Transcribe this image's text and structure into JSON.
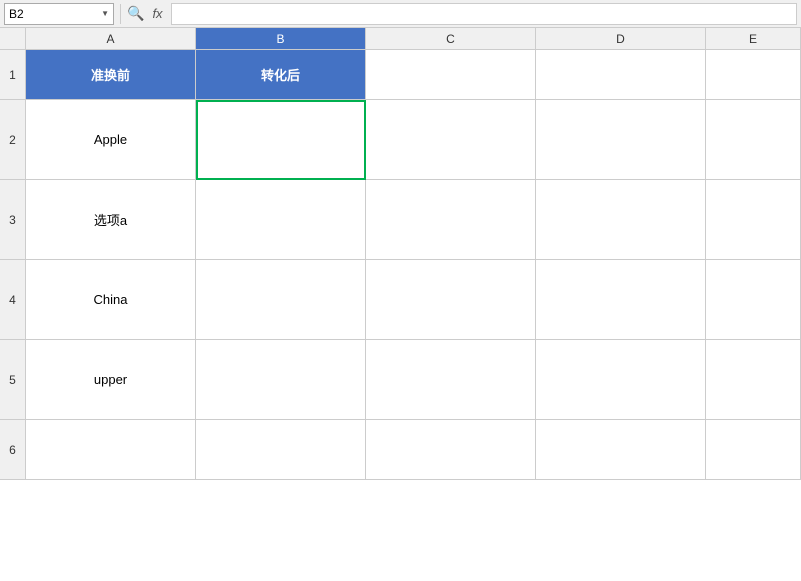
{
  "namebox": {
    "value": "B2",
    "arrow": "▼"
  },
  "formula_bar": {
    "zoom_icon": "🔍",
    "fx_label": "fx"
  },
  "columns": [
    {
      "id": "row_num",
      "label": ""
    },
    {
      "id": "A",
      "label": "A"
    },
    {
      "id": "B",
      "label": "B"
    },
    {
      "id": "C",
      "label": "C"
    },
    {
      "id": "D",
      "label": "D"
    },
    {
      "id": "E",
      "label": "E"
    }
  ],
  "rows": [
    {
      "num": "1",
      "cells": [
        {
          "col": "A",
          "value": "准换前",
          "type": "header"
        },
        {
          "col": "B",
          "value": "转化后",
          "type": "header"
        },
        {
          "col": "C",
          "value": "",
          "type": "empty"
        },
        {
          "col": "D",
          "value": "",
          "type": "empty"
        },
        {
          "col": "E",
          "value": "",
          "type": "empty"
        }
      ]
    },
    {
      "num": "2",
      "cells": [
        {
          "col": "A",
          "value": "Apple",
          "type": "normal"
        },
        {
          "col": "B",
          "value": "",
          "type": "selected"
        },
        {
          "col": "C",
          "value": "",
          "type": "empty"
        },
        {
          "col": "D",
          "value": "",
          "type": "empty"
        },
        {
          "col": "E",
          "value": "",
          "type": "empty"
        }
      ]
    },
    {
      "num": "3",
      "cells": [
        {
          "col": "A",
          "value": "选项a",
          "type": "normal"
        },
        {
          "col": "B",
          "value": "",
          "type": "normal"
        },
        {
          "col": "C",
          "value": "",
          "type": "empty"
        },
        {
          "col": "D",
          "value": "",
          "type": "empty"
        },
        {
          "col": "E",
          "value": "",
          "type": "empty"
        }
      ]
    },
    {
      "num": "4",
      "cells": [
        {
          "col": "A",
          "value": "China",
          "type": "normal"
        },
        {
          "col": "B",
          "value": "",
          "type": "normal"
        },
        {
          "col": "C",
          "value": "",
          "type": "empty"
        },
        {
          "col": "D",
          "value": "",
          "type": "empty"
        },
        {
          "col": "E",
          "value": "",
          "type": "empty"
        }
      ]
    },
    {
      "num": "5",
      "cells": [
        {
          "col": "A",
          "value": "upper",
          "type": "normal"
        },
        {
          "col": "B",
          "value": "",
          "type": "normal"
        },
        {
          "col": "C",
          "value": "",
          "type": "empty"
        },
        {
          "col": "D",
          "value": "",
          "type": "empty"
        },
        {
          "col": "E",
          "value": "",
          "type": "empty"
        }
      ]
    },
    {
      "num": "6",
      "cells": [
        {
          "col": "A",
          "value": "",
          "type": "empty"
        },
        {
          "col": "B",
          "value": "",
          "type": "empty"
        },
        {
          "col": "C",
          "value": "",
          "type": "empty"
        },
        {
          "col": "D",
          "value": "",
          "type": "empty"
        },
        {
          "col": "E",
          "value": "",
          "type": "empty"
        }
      ]
    }
  ]
}
